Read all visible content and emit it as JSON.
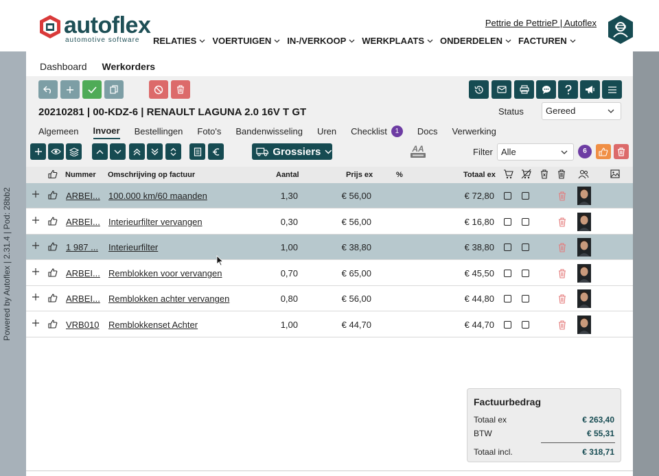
{
  "brand": {
    "name": "autoflex",
    "tagline": "automotive software",
    "color": "#1e4f56"
  },
  "user": {
    "link": "Pettrie de PettrieP | Autoflex"
  },
  "nav": [
    "RELATIES",
    "VOERTUIGEN",
    "IN-/VERKOOP",
    "WERKPLAATS",
    "ONDERDELEN",
    "FACTUREN"
  ],
  "sidebar": {
    "powered": "Powered by Autoflex | 2.31.4 | Pod: 28bb2"
  },
  "pagetabs": [
    {
      "label": "Dashboard",
      "active": false
    },
    {
      "label": "Werkorders",
      "active": true
    }
  ],
  "workorder": {
    "title": "20210281 | 00-KDZ-6 | RENAULT LAGUNA 2.0 16V T GT"
  },
  "status": {
    "label": "Status",
    "value": "Gereed"
  },
  "subtabs": [
    {
      "label": "Algemeen",
      "active": false
    },
    {
      "label": "Invoer",
      "active": true
    },
    {
      "label": "Bestellingen",
      "active": false
    },
    {
      "label": "Foto's",
      "active": false
    },
    {
      "label": "Bandenwisseling",
      "active": false
    },
    {
      "label": "Uren",
      "active": false
    },
    {
      "label": "Checklist",
      "active": false,
      "badge": "1"
    },
    {
      "label": "Docs",
      "active": false
    },
    {
      "label": "Verwerking",
      "active": false
    }
  ],
  "toolbar": {
    "grossiers": "Grossiers",
    "filter_label": "Filter",
    "filter_value": "Alle",
    "count_badge": "6"
  },
  "table": {
    "headers": {
      "nummer": "Nummer",
      "omschrijving": "Omschrijving op factuur",
      "aantal": "Aantal",
      "prijs": "Prijs ex",
      "pct": "%",
      "totaal": "Totaal ex"
    },
    "rows": [
      {
        "nummer": "ARBEI...",
        "omschrijving": "100.000 km/60 maanden",
        "aantal": "1,30",
        "prijs": "€ 56,00",
        "totaal": "€ 72,80",
        "highlight": true
      },
      {
        "nummer": "ARBEI...",
        "omschrijving": "Interieurfilter vervangen",
        "aantal": "0,30",
        "prijs": "€ 56,00",
        "totaal": "€ 16,80",
        "highlight": false
      },
      {
        "nummer": "1 987 ...",
        "omschrijving": "Interieurfilter",
        "aantal": "1,00",
        "prijs": "€ 38,80",
        "totaal": "€ 38,80",
        "highlight": true
      },
      {
        "nummer": "ARBEI...",
        "omschrijving": "Remblokken voor vervangen",
        "aantal": "0,70",
        "prijs": "€ 65,00",
        "totaal": "€ 45,50",
        "highlight": false
      },
      {
        "nummer": "ARBEI...",
        "omschrijving": "Remblokken achter vervangen",
        "aantal": "0,80",
        "prijs": "€ 56,00",
        "totaal": "€ 44,80",
        "highlight": false
      },
      {
        "nummer": "VRB010",
        "omschrijving": "Remblokkenset Achter",
        "aantal": "1,00",
        "prijs": "€ 44,70",
        "totaal": "€ 44,70",
        "highlight": false
      }
    ]
  },
  "summary": {
    "title": "Factuurbedrag",
    "totaal_ex_label": "Totaal ex",
    "totaal_ex": "€ 263,40",
    "btw_label": "BTW",
    "btw": "€ 55,31",
    "totaal_incl_label": "Totaal incl.",
    "totaal_incl": "€ 318,71"
  },
  "colors": {
    "primary": "#164b52",
    "highlight_row": "#b7c8cd",
    "green": "#4fab57",
    "red": "#dc6a6a",
    "orange": "#f08f45",
    "purple": "#6d3ca3"
  }
}
